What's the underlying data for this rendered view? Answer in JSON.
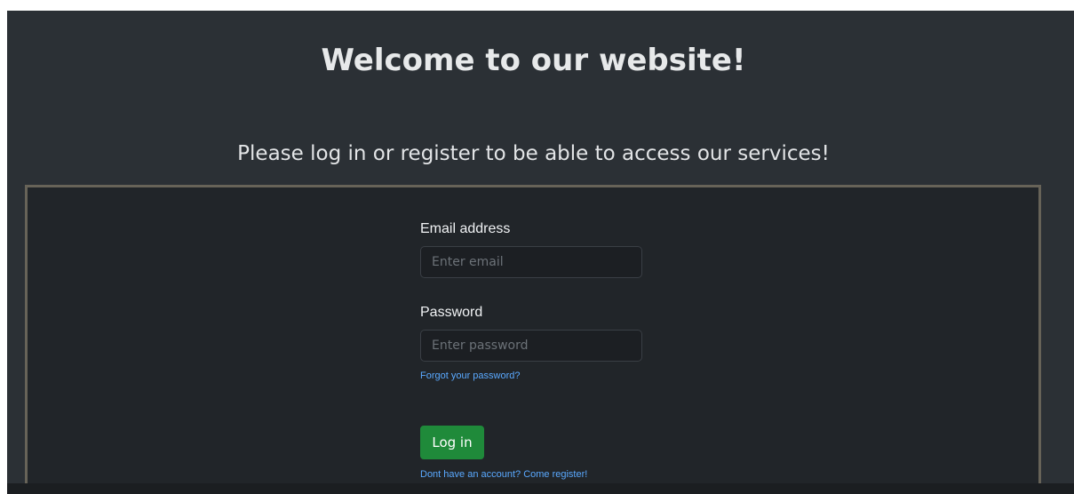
{
  "header": {
    "title": "Welcome to our website!",
    "subtitle": "Please log in or register to be able to access our services!"
  },
  "login_form": {
    "email_label": "Email address",
    "email_placeholder": "Enter email",
    "email_value": "",
    "password_label": "Password",
    "password_placeholder": "Enter password",
    "password_value": "",
    "forgot_password_link": "Forgot your password?",
    "login_button_label": "Log in",
    "register_link": "Dont have an account? Come register!"
  },
  "colors": {
    "page_background": "#2b3035",
    "card_background": "#212529",
    "card_border": "#676358",
    "button_green": "#1f8a3a",
    "link_blue": "#5aa9ff"
  }
}
